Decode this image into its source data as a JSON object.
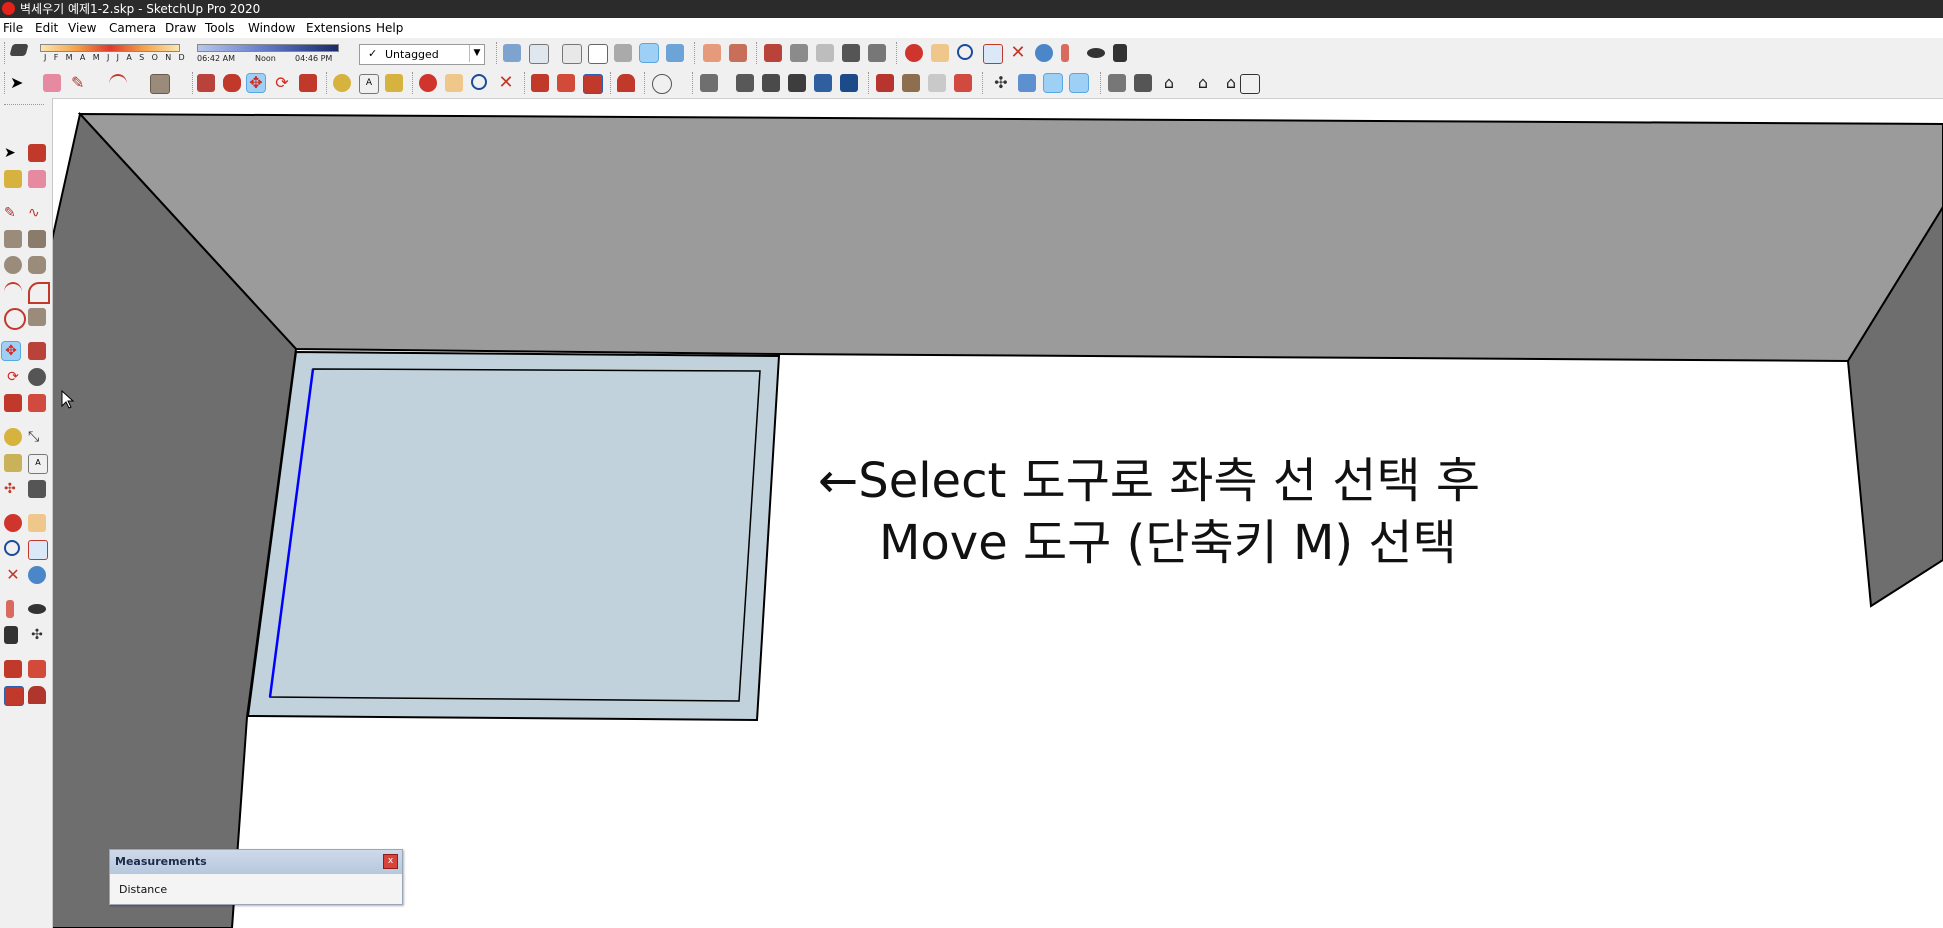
{
  "window": {
    "title": "벽세우기 예제1-2.skp - SketchUp Pro 2020"
  },
  "menu": [
    "File",
    "Edit",
    "View",
    "Camera",
    "Draw",
    "Tools",
    "Window",
    "Extensions",
    "Help"
  ],
  "shadow_settings": {
    "months_label": "J F M A M J J A S O N D",
    "sunrise": "06:42 AM",
    "noon": "Noon",
    "sunset": "04:46 PM"
  },
  "tag_select": {
    "value": "Untagged",
    "check_glyph": "✓",
    "arrow_glyph": "▼"
  },
  "toolbar_icons": {
    "row1": [
      "eraser-icon",
      "iso-view-icon",
      "top-view-icon",
      "front-view-icon",
      "right-view-icon",
      "back-view-icon",
      "left-view-icon",
      "xray-icon",
      "back-edges-icon",
      "wireframe-icon",
      "hidden-line-icon",
      "shaded-icon",
      "shaded-textures-icon",
      "monochrome-icon",
      "section-plane-icon",
      "section-display-icon",
      "section-cut-icon",
      "outer-shell-icon",
      "intersect-icon",
      "union-icon",
      "subtract-icon",
      "trim-icon",
      "split-icon",
      "orbit-icon",
      "pan-icon",
      "zoom-icon",
      "zoom-window-icon",
      "zoom-extents-icon",
      "zoom-previous-icon",
      "position-camera-icon",
      "look-around-icon",
      "walk-icon"
    ],
    "row2": [
      "select-icon",
      "eraser-icon",
      "pencil-icon",
      "arc-icon",
      "rectangle-icon",
      "push-pull-icon",
      "follow-me-icon",
      "move-icon",
      "rotate-icon",
      "scale-icon",
      "tape-measure-icon",
      "text-icon",
      "paint-bucket-icon",
      "orbit-icon",
      "pan-icon",
      "zoom-icon",
      "zoom-extents-icon",
      "warehouse-icon",
      "extension-warehouse-icon",
      "layout-icon",
      "send-to-layout-icon",
      "user-icon",
      "style-1-icon",
      "style-2-icon",
      "style-3-icon",
      "style-4-icon",
      "style-5-icon",
      "style-6-icon",
      "sandbox-1-icon",
      "sandbox-2-icon",
      "sandbox-3-icon",
      "sandbox-4-icon",
      "axes-icon",
      "iso-view-icon",
      "iso-front-icon",
      "iso-right-icon",
      "house-1-icon",
      "house-2-icon",
      "house-3-icon",
      "house-4-icon",
      "house-5-icon"
    ]
  },
  "left_tools": [
    "select-icon",
    "make-component-icon",
    "paint-bucket-icon",
    "eraser-icon",
    "line-icon",
    "freehand-icon",
    "rectangle-icon",
    "rotated-rectangle-icon",
    "circle-icon",
    "polygon-icon",
    "arc-icon",
    "pie-icon",
    "two-point-arc-icon",
    "three-point-arc-icon",
    "move-icon",
    "push-pull-icon",
    "rotate-icon",
    "follow-me-icon",
    "scale-icon",
    "offset-icon",
    "tape-measure-icon",
    "dimension-icon",
    "protractor-icon",
    "text-icon",
    "axes-icon",
    "3d-text-icon",
    "orbit-icon",
    "pan-icon",
    "zoom-icon",
    "zoom-window-icon",
    "zoom-extents-icon",
    "previous-view-icon",
    "position-camera-icon",
    "look-around-icon",
    "walk-icon",
    "section-plane-icon",
    "warehouse-icon",
    "extension-warehouse-icon",
    "send-to-layout-icon",
    "extension-manager-icon"
  ],
  "annotation": {
    "line1": "←Select 도구로 좌측 선 선택 후",
    "line2": "Move 도구 (단축키 M) 선택"
  },
  "measurements": {
    "title": "Measurements",
    "label": "Distance",
    "close_glyph": "x"
  },
  "colors": {
    "titlebar": "#2b2b2b",
    "toolbar": "#f0f0f0",
    "wall_top": "#9b9b9b",
    "wall_dark": "#6e6e6e",
    "floor": "#ffffff",
    "selection_face": "#c2d2dd",
    "selection_edge": "#0000ff",
    "active_tool": "#9ed0f5"
  }
}
